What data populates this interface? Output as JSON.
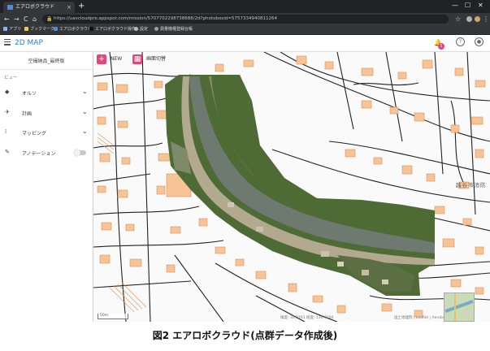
{
  "browser": {
    "tab_title": "エアロボクラウド",
    "tab_close": "×",
    "new_tab": "+",
    "window_controls": [
      "—",
      "☐",
      "✕"
    ],
    "nav_back": "←",
    "nav_forward": "→",
    "nav_reload": "C",
    "nav_home": "⌂",
    "url": "https://uavcloudpro.appspot.com/mission/5707702298738688/2d?photoboxid=5757334940811264",
    "bookmarks": [
      {
        "label": "アプリ",
        "color": "#8ab4f8"
      },
      {
        "label": "ブックマーク",
        "color": "#f2c94c"
      },
      {
        "label": "エアロボクラウド",
        "color": "#4a8fd6"
      },
      {
        "label": "エアロボクラウド操作...",
        "color": "#222222"
      },
      {
        "label": "設定",
        "color": "#bdbdbd"
      },
      {
        "label": "測量機種登録台帳",
        "color": "#9e9e9e"
      }
    ]
  },
  "app": {
    "title": "2D MAP",
    "notification_count": "1",
    "help_icon": "?",
    "account_icon": "●"
  },
  "sidebar": {
    "project_name": "空撮納品_最終版",
    "view_label": "ビュー",
    "items": [
      {
        "label": "オルソ",
        "icon": "◆",
        "chevron": "⌄"
      },
      {
        "label": "計画",
        "icon": "✈",
        "chevron": "⌄"
      },
      {
        "label": "マッピング",
        "icon": "⁞",
        "chevron": "⌄"
      },
      {
        "label": "アノテーション",
        "icon": "✎"
      }
    ]
  },
  "map": {
    "new_button": {
      "icon": "+",
      "label": "NEW",
      "color": "#e8457d"
    },
    "split_button": {
      "icon": "▦",
      "label": "画面切替",
      "color": "#e8457d"
    },
    "place_label": "越谷市消防",
    "coordinates": "緯度: 35.8761   経度: 139.7600",
    "attribution": "国土地理院 | Leaflet | Aerobo Inc.",
    "scale_label": "50m"
  },
  "colors": {
    "accent": "#2d7fd3",
    "pink": "#e8457d",
    "building": "#f7c497",
    "building_stroke": "#d9925a",
    "road": "#222222",
    "water": "#6e7a70",
    "vegetation": "#4e6a35"
  },
  "caption": "図2  エアロボクラウド(点群データ作成後)"
}
